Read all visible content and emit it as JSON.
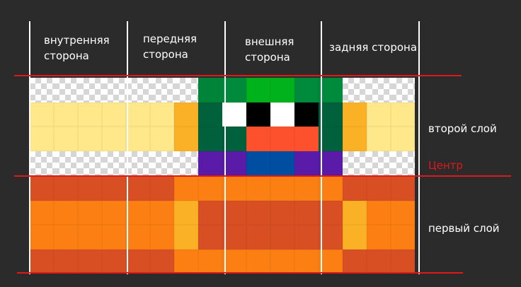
{
  "column_labels": {
    "inner": [
      "внутренняя",
      "сторона"
    ],
    "front": [
      "передняя",
      "сторона"
    ],
    "outer": [
      "внешняя",
      "сторона"
    ],
    "back": [
      "задняя сторона"
    ]
  },
  "row_labels": {
    "second_layer": "второй слой",
    "center": "Центр",
    "first_layer": "первый слой"
  },
  "colors": {
    "background": "#2b2b2b",
    "center_line": "#e01818",
    "divider": "#ffffff"
  },
  "top_rows": [
    [
      "T",
      "T",
      "T",
      "T",
      "T",
      "T",
      "T",
      "#00843a",
      "#008a3c",
      "#00b21c",
      "#00b21c",
      "#008a3c",
      "#008a3c",
      "T",
      "T",
      "T"
    ],
    [
      "#ffe88a",
      "#ffe88a",
      "#ffe88a",
      "#ffe88a",
      "#ffe88a",
      "#ffe88a",
      "#fbb126",
      "#00613c",
      "#ffffff",
      "#000000",
      "#ffffff",
      "#000000",
      "#00613c",
      "#fbb126",
      "#ffe88a",
      "#ffe88a"
    ],
    [
      "#ffe88a",
      "#ffe88a",
      "#ffe88a",
      "#ffe88a",
      "#ffe88a",
      "#ffe88a",
      "#fbb126",
      "#00613c",
      "#00613c",
      "#fc512c",
      "#fc512c",
      "#fc512c",
      "#00613c",
      "#fbb126",
      "#ffe88a",
      "#ffe88a"
    ],
    [
      "T",
      "T",
      "T",
      "T",
      "T",
      "T",
      "T",
      "#5a1ba8",
      "#5a1ba8",
      "#004ea2",
      "#004ea2",
      "#5a1ba8",
      "#5a1ba8",
      "T",
      "T",
      "T"
    ]
  ],
  "bottom_rows": [
    [
      "#d94f24",
      "#d94f24",
      "#d94f24",
      "#d94f24",
      "#d94f24",
      "#d94f24",
      "#fc7f14",
      "#fc7f14",
      "#fc7f14",
      "#fc7f14",
      "#fc7f14",
      "#fc7f14",
      "#fc7f14",
      "#d94f24",
      "#d94f24",
      "#d94f24"
    ],
    [
      "#fc7f14",
      "#fc7f14",
      "#fc7f14",
      "#fc7f14",
      "#fc7f14",
      "#fc7f14",
      "#fbb126",
      "#d94f24",
      "#d94f24",
      "#d94f24",
      "#d94f24",
      "#d94f24",
      "#d94f24",
      "#fbb126",
      "#fc7f14",
      "#fc7f14"
    ],
    [
      "#fc7f14",
      "#fc7f14",
      "#fc7f14",
      "#fc7f14",
      "#fc7f14",
      "#fc7f14",
      "#fbb126",
      "#d94f24",
      "#d94f24",
      "#d94f24",
      "#d94f24",
      "#d94f24",
      "#d94f24",
      "#fbb126",
      "#fc7f14",
      "#fc7f14"
    ],
    [
      "#d94f24",
      "#d94f24",
      "#d94f24",
      "#d94f24",
      "#d94f24",
      "#d94f24",
      "#fc7f14",
      "#fc7f14",
      "#fc7f14",
      "#fc7f14",
      "#fc7f14",
      "#fc7f14",
      "#fc7f14",
      "#d94f24",
      "#d94f24",
      "#d94f24"
    ]
  ]
}
